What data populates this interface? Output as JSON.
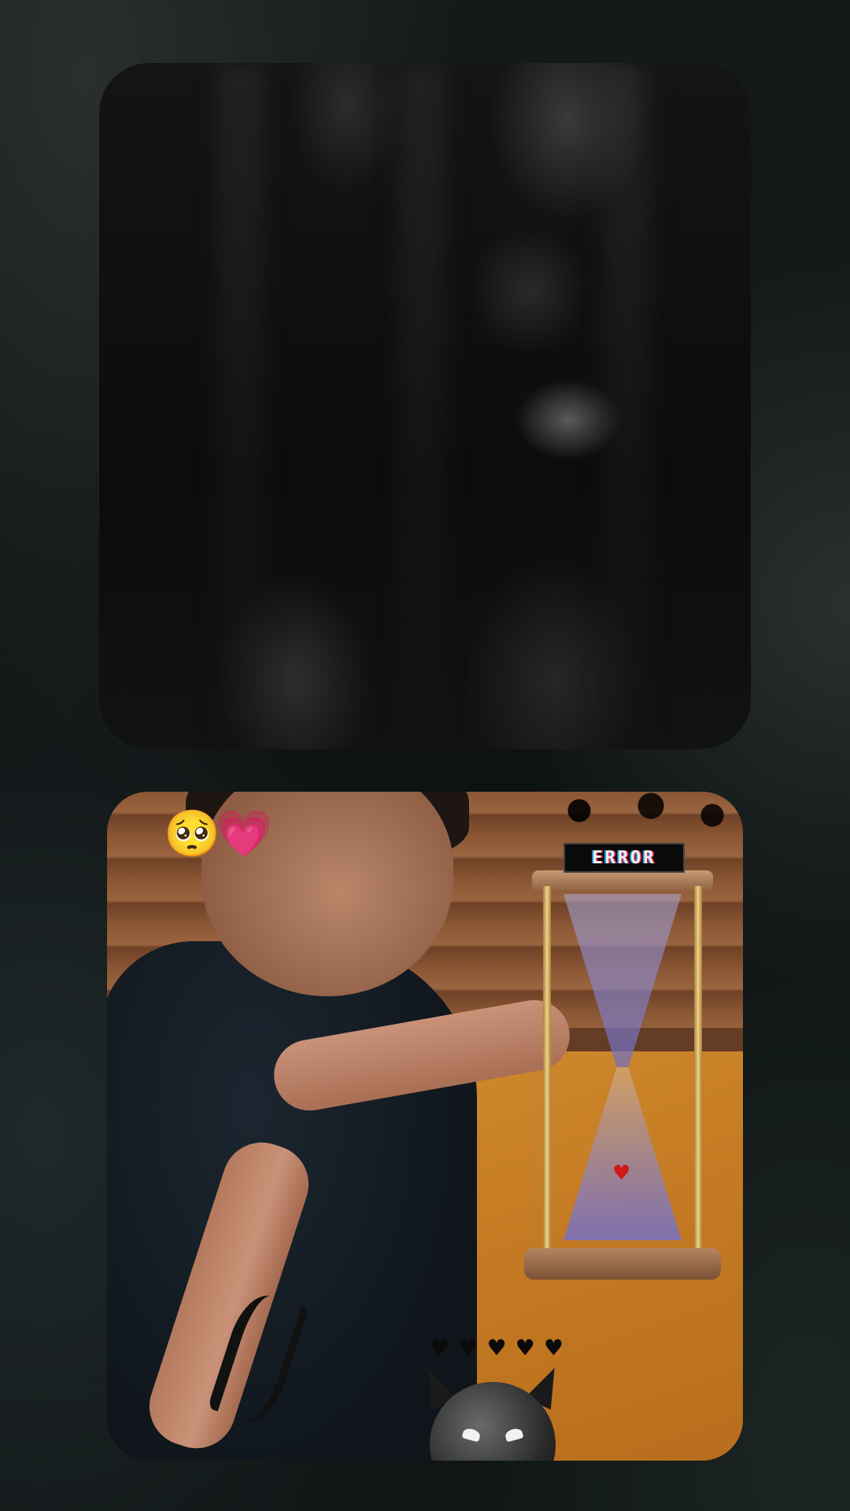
{
  "stickers": {
    "pleading_face": "🥺",
    "pink_heart": "💗",
    "plate_text": "ERROR",
    "mini_heart": "♥",
    "hourglass_heart": "♥"
  },
  "colors": {
    "background": "#0b1010",
    "wood_desk": "#c47a22",
    "sand": "#7070d0"
  }
}
